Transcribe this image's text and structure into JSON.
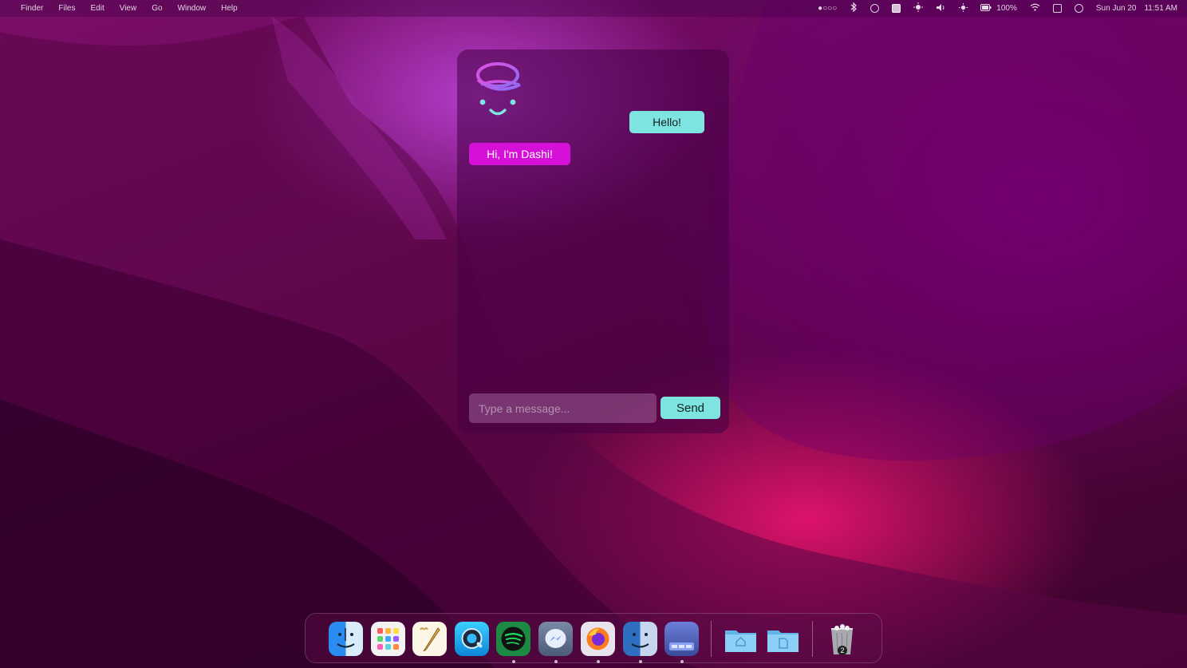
{
  "menubar": {
    "apple_glyph": "",
    "menus": [
      "Finder",
      "Files",
      "Edit",
      "View",
      "Go",
      "Window",
      "Help"
    ],
    "status_dots": "●○○○",
    "battery_percent": "100%",
    "date": "Sun Jun 20",
    "time": "11:51 AM",
    "status_icons": [
      "bluetooth-icon",
      "check-circle-icon",
      "screen-icon",
      "brightness-icon",
      "volume-icon",
      "sun-icon",
      "battery-icon",
      "wifi-icon",
      "clipboard-icon",
      "user-icon"
    ]
  },
  "chat": {
    "avatar_icon": "dashi-face-icon",
    "user_message": "Hello!",
    "bot_message": "Hi, I'm Dashi!",
    "input_placeholder": "Type a message...",
    "input_value": "",
    "send_label": "Send",
    "colors": {
      "user_bubble": "#7de4e0",
      "bot_bubble": "#d511d8",
      "send_button": "#7de4e0"
    }
  },
  "dock": {
    "apps": [
      {
        "name": "finder-icon",
        "running": false
      },
      {
        "name": "launchpad-icon",
        "running": false
      },
      {
        "name": "textedit-icon",
        "running": false
      },
      {
        "name": "quicktime-icon",
        "running": false
      },
      {
        "name": "spotify-icon",
        "running": true
      },
      {
        "name": "messenger-icon",
        "running": true
      },
      {
        "name": "firefox-icon",
        "running": true
      },
      {
        "name": "finder-alt-icon",
        "running": true
      },
      {
        "name": "window-app-icon",
        "running": true
      }
    ],
    "folders": [
      "home-folder-icon",
      "documents-folder-icon"
    ],
    "trash_badge": "2"
  }
}
